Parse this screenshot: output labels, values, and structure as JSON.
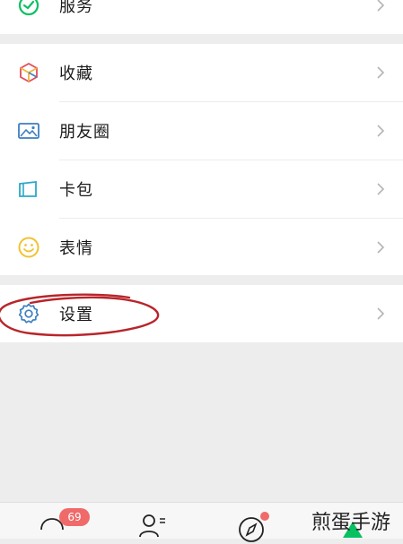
{
  "menu": {
    "service": {
      "label": "服务",
      "icon": "service-icon"
    },
    "favorites": {
      "label": "收藏",
      "icon": "favorites-cube-icon"
    },
    "moments": {
      "label": "朋友圈",
      "icon": "moments-image-icon"
    },
    "cards": {
      "label": "卡包",
      "icon": "card-wallet-icon"
    },
    "stickers": {
      "label": "表情",
      "icon": "sticker-smile-icon"
    },
    "settings": {
      "label": "设置",
      "icon": "settings-gear-icon"
    }
  },
  "tabbar": {
    "chats_badge": "69",
    "tabs": [
      "chats-tab",
      "contacts-tab",
      "discover-tab",
      "me-tab"
    ]
  },
  "watermark": "煎蛋手游",
  "colors": {
    "accent_green": "#07c160",
    "badge_red": "#f06a6a",
    "icon_blue": "#3d7fc1",
    "annotation_red": "#b8252b"
  }
}
